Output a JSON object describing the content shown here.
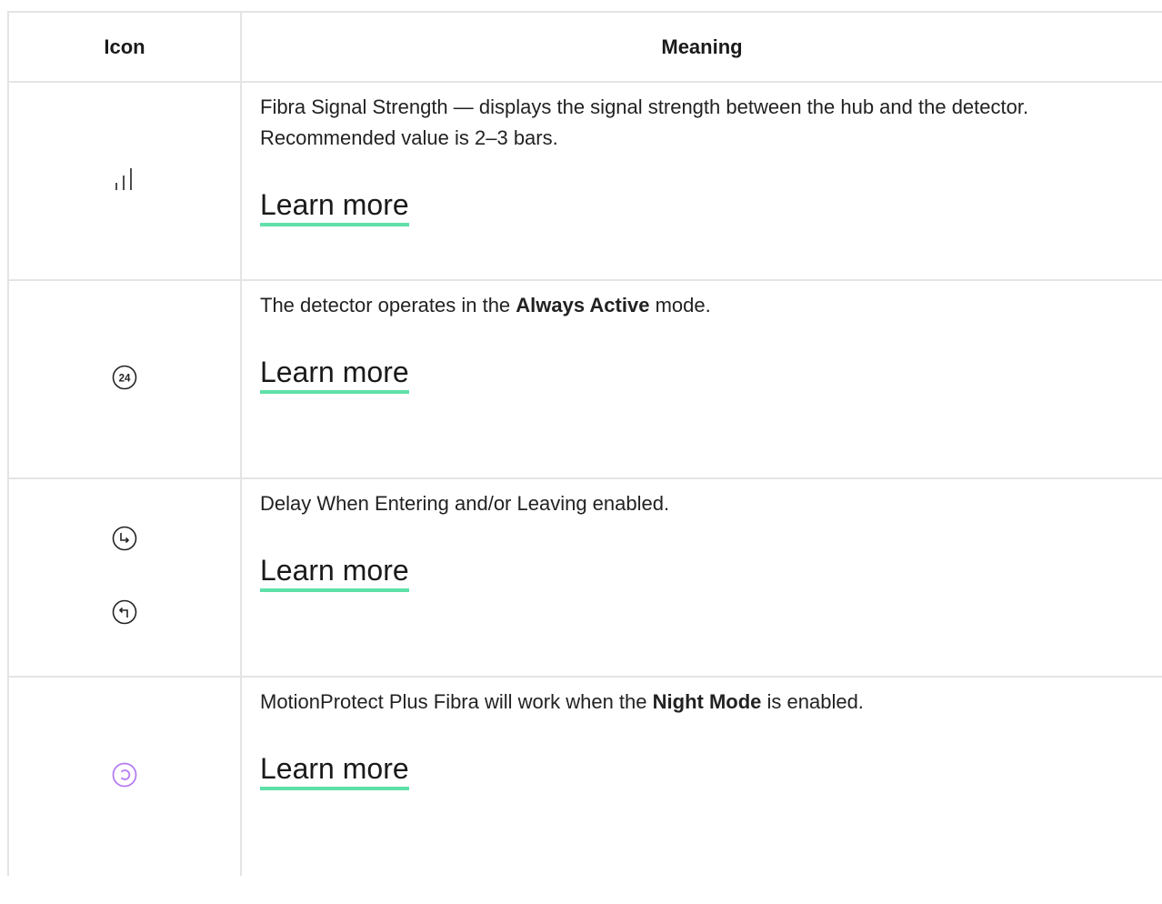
{
  "table": {
    "headers": {
      "icon": "Icon",
      "meaning": "Meaning"
    },
    "rows": [
      {
        "icons": [
          "signal-strength-icon"
        ],
        "text_before": "Fibra Signal Strength — displays the signal strength between the hub and the detector. Recommended value is 2–3 bars.",
        "bold": "",
        "text_after": "",
        "link": "Learn more"
      },
      {
        "icons": [
          "always-active-24-icon"
        ],
        "text_before": "The detector operates in the ",
        "bold": "Always Active",
        "text_after": " mode.",
        "link": "Learn more",
        "icon_label": "24"
      },
      {
        "icons": [
          "delay-entering-icon",
          "delay-leaving-icon"
        ],
        "text_before": "Delay When Entering and/or Leaving enabled.",
        "bold": "",
        "text_after": "",
        "link": "Learn more"
      },
      {
        "icons": [
          "night-mode-icon"
        ],
        "text_before": "MotionProtect Plus Fibra will work when the ",
        "bold": "Night Mode",
        "text_after": " is enabled.",
        "link": "Learn more"
      }
    ]
  },
  "colors": {
    "border": "#e4e4e4",
    "link_underline": "#5ee0a8",
    "night_mode_icon": "#b57cf2",
    "text": "#222222"
  }
}
